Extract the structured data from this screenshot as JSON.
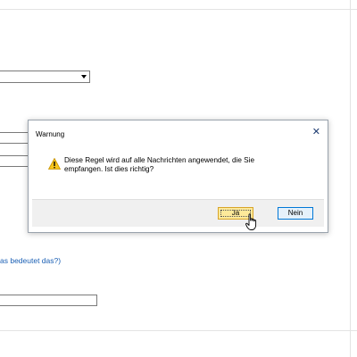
{
  "dialog": {
    "title": "Warnung",
    "close_glyph": "✕",
    "message": "Diese Regel wird auf alle Nachrichten angewendet, die Sie empfangen. Ist dies richtig?",
    "yes_label": "Ja",
    "no_label": "Nein"
  },
  "background": {
    "link_text": "as bedeutet das?)"
  }
}
